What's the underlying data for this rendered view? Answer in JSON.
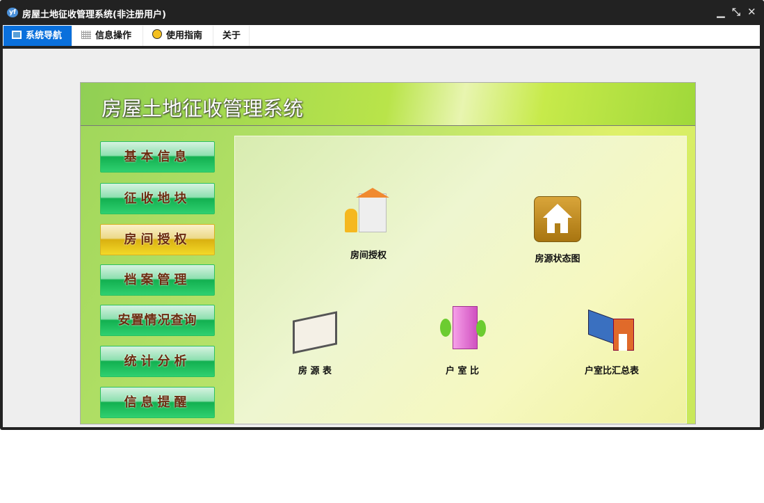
{
  "window": {
    "title": "房屋土地征收管理系统(非注册用户)",
    "logo": "yf",
    "controls": [
      "minimize",
      "restore",
      "close"
    ]
  },
  "tabs": [
    {
      "label": "系统导航",
      "icon": "monitor-icon",
      "selected": true
    },
    {
      "label": "信息操作",
      "icon": "grid-icon"
    },
    {
      "label": "使用指南",
      "icon": "help-icon"
    },
    {
      "label": "关于"
    }
  ],
  "panel": {
    "title": "房屋土地征收管理系统"
  },
  "nav": [
    {
      "label": "基本信息"
    },
    {
      "label": "征收地块"
    },
    {
      "label": "房间授权",
      "selected": true
    },
    {
      "label": "档案管理"
    },
    {
      "label": "安置情况查询"
    },
    {
      "label": "统计分析"
    },
    {
      "label": "信息提醒"
    }
  ],
  "items": [
    {
      "label": "房间授权",
      "icon": "building-people-icon"
    },
    {
      "label": "房源状态图",
      "icon": "house-icon"
    },
    {
      "label": "房 源 表",
      "icon": "binder-icon"
    },
    {
      "label": "户 室 比",
      "icon": "pink-building-icon"
    },
    {
      "label": "户室比汇总表",
      "icon": "books-house-icon"
    }
  ]
}
